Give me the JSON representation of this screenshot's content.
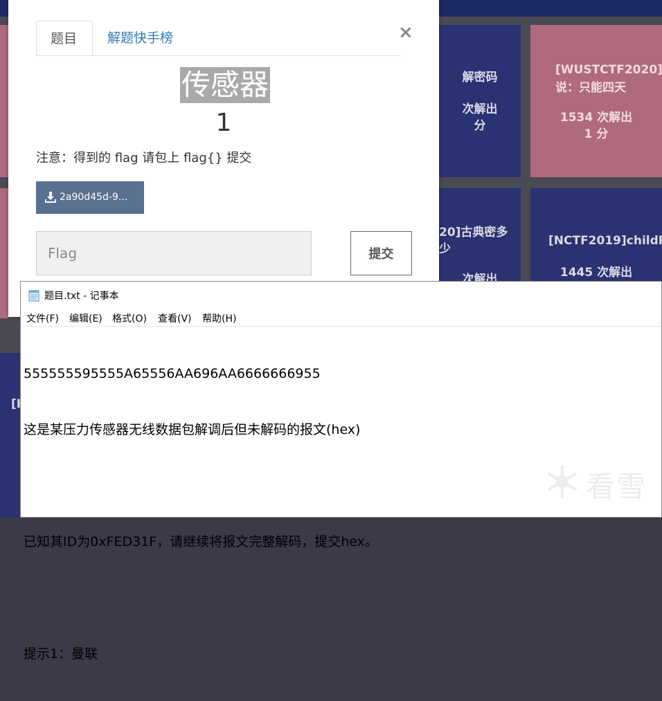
{
  "board": {
    "tiles": [
      {
        "title": "解密码",
        "solves": "次解出",
        "score": "分"
      },
      {
        "title": "[WUSTCTF2020]说：只能四天",
        "solves": "1534 次解出",
        "score": "1 分"
      },
      {
        "title": "20]古典密多少",
        "solves": "次解出",
        "score": ""
      },
      {
        "title": "[NCTF2019]childR",
        "solves": "1445 次解出",
        "score": ""
      },
      {
        "title": "[H",
        "solves": "",
        "score": ""
      }
    ]
  },
  "modal": {
    "tabs": [
      {
        "label": "题目"
      },
      {
        "label": "解题快手榜"
      }
    ],
    "close": "×",
    "challenge_name": "传感器",
    "challenge_value": "1",
    "note": "注意：得到的 flag 请包上 flag{} 提交",
    "download_label": "2a90d45d-9...",
    "flag_placeholder": "Flag",
    "submit_label": "提交"
  },
  "notepad": {
    "title": "题目.txt - 记事本",
    "menu": [
      "文件(F)",
      "编辑(E)",
      "格式(O)",
      "查看(V)",
      "帮助(H)"
    ],
    "lines": [
      "555555595555A65556AA696AA6666666955",
      "这是某压力传感器无线数据包解调后但未解码的报文(hex)",
      "",
      "已知其ID为0xFED31F，请继续将报文完整解码，提交hex。",
      "",
      "提示1：曼联"
    ]
  },
  "watermark": {
    "text": "看雪"
  }
}
